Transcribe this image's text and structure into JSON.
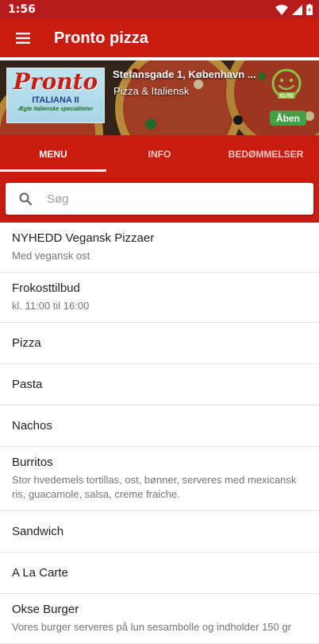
{
  "status": {
    "time": "1:56"
  },
  "appbar": {
    "title": "Pronto pizza"
  },
  "restaurant": {
    "logo_text": "Pronto",
    "logo_sub": "ITALIANA II",
    "logo_tagline": "Ægte italienske specialiteter",
    "address": "Stefansgade 1, København ...",
    "category": "Pizza & Italiensk",
    "elite_label": "ELITE",
    "open_status": "Åben",
    "open_color": "#43a047"
  },
  "tabs": [
    {
      "label": "MENU",
      "active": true
    },
    {
      "label": "INFO",
      "active": false
    },
    {
      "label": "BEDØMMELSER",
      "active": false
    }
  ],
  "search": {
    "placeholder": "Søg",
    "value": ""
  },
  "menu": [
    {
      "name": "NYHEDD Vegansk Pizzaer",
      "desc": "Med vegansk ost"
    },
    {
      "name": "Frokosttilbud",
      "desc": "kl. 11:00 til 16:00"
    },
    {
      "name": "Pizza",
      "desc": ""
    },
    {
      "name": "Pasta",
      "desc": ""
    },
    {
      "name": "Nachos",
      "desc": ""
    },
    {
      "name": "Burritos",
      "desc": "Stor hvedemels tortillas, ost, bønner, serveres med mexicansk ris, guacamole, salsa, creme fraiche."
    },
    {
      "name": "Sandwich",
      "desc": ""
    },
    {
      "name": "A La Carte",
      "desc": ""
    },
    {
      "name": "Okse Burger",
      "desc": "Vores burger serveres på lun sesambolle og indholder 150 gr"
    }
  ],
  "colors": {
    "brand": "#c81c11",
    "statusbar": "#b71c1c"
  }
}
